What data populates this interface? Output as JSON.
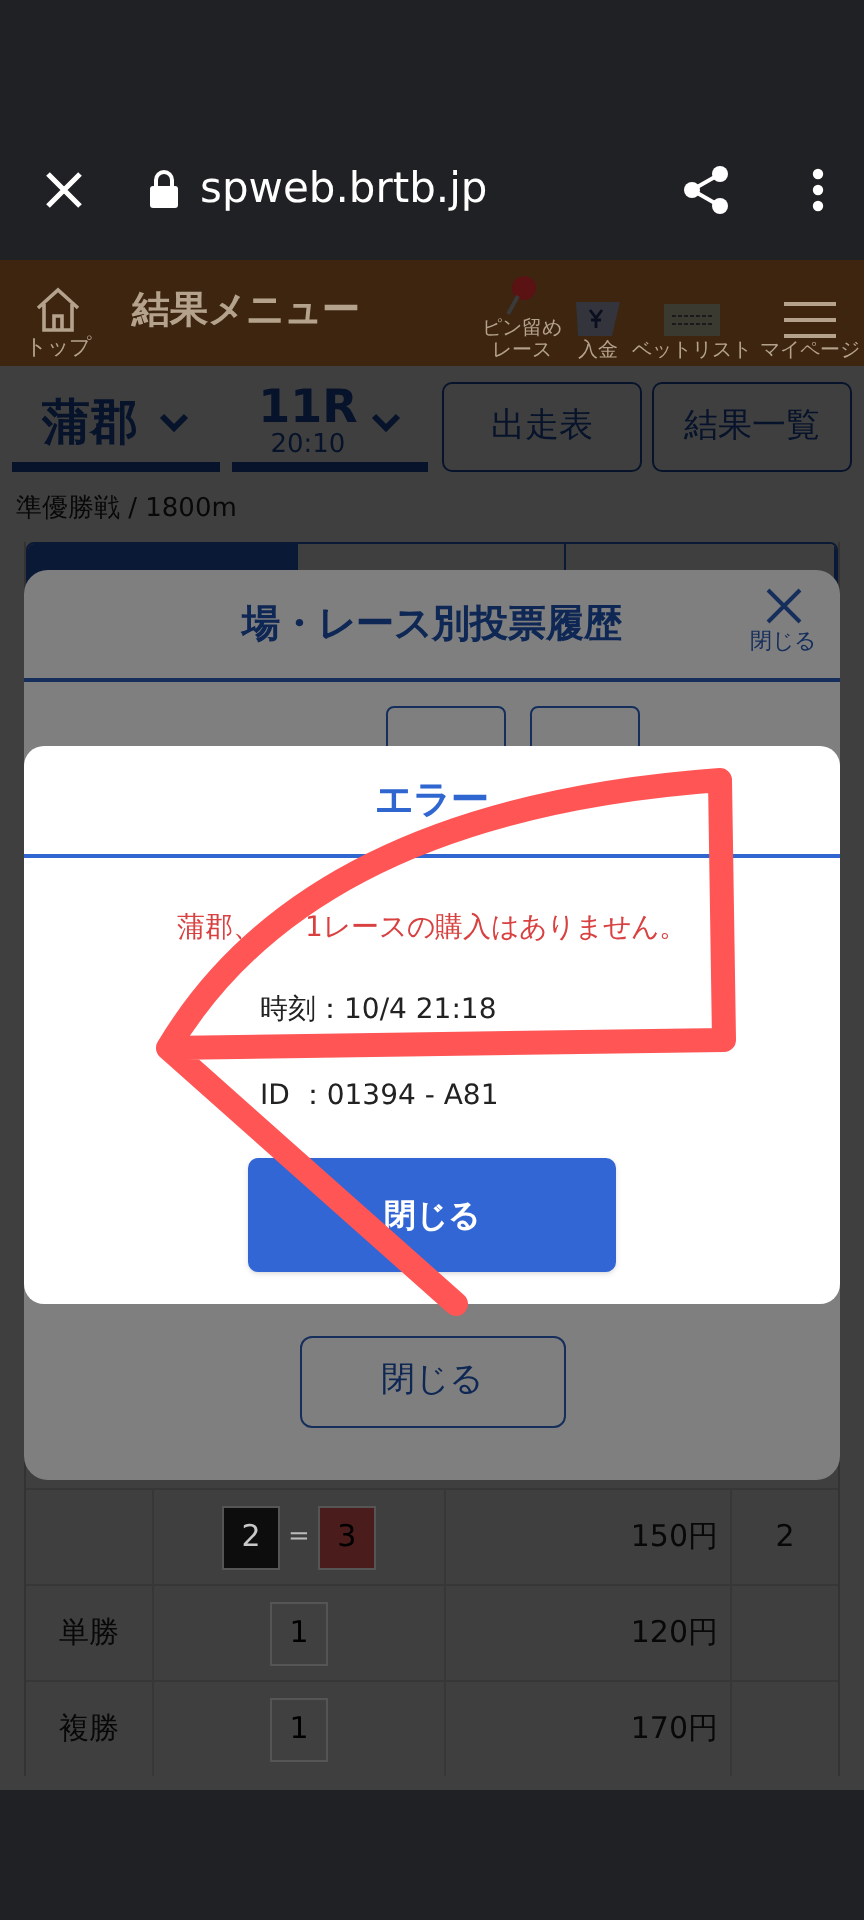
{
  "browser": {
    "url": "spweb.brtb.jp"
  },
  "header": {
    "home_label": "トップ",
    "title": "結果メニュー",
    "nav": [
      {
        "kind": "pin",
        "label": "ピン留めレース"
      },
      {
        "kind": "yen",
        "label": "入金"
      },
      {
        "kind": "betlist",
        "label": "ベットリスト"
      },
      {
        "kind": "menu",
        "label": "マイページ"
      }
    ]
  },
  "race_bar": {
    "venue": "蒲郡",
    "race": "11R",
    "time": "20:10",
    "buttons": [
      "出走表",
      "結果一覧"
    ]
  },
  "race_info": "準優勝戦 / 1800m",
  "tabs": [
    {
      "selected": true
    },
    {
      "selected": false
    },
    {
      "selected": false
    }
  ],
  "results": [
    {
      "combo": [
        {
          "number": "2",
          "color": "#0d0d0d"
        },
        {
          "number": "3",
          "color": "#4a1c1c"
        }
      ],
      "joiner": "=",
      "payout": "150円",
      "popularity": "2"
    },
    {
      "bet": "単勝",
      "combo": [
        {
          "number": "1",
          "color": "#404040"
        }
      ],
      "payout": "120円"
    },
    {
      "bet": "複勝",
      "combo": [
        {
          "number": "1",
          "color": "#404040"
        }
      ],
      "payout": "170円"
    }
  ],
  "history_modal": {
    "title": "場・レース別投票履歴",
    "close_label": "閉じる",
    "close_button": "閉じる"
  },
  "error_dialog": {
    "title": "エラー",
    "message_parts": [
      "蒲郡、",
      "1レースの購入はありません。"
    ],
    "time": "時刻：10/4 21:18",
    "id": "ID ：01394 - A81",
    "button": "閉じる"
  }
}
